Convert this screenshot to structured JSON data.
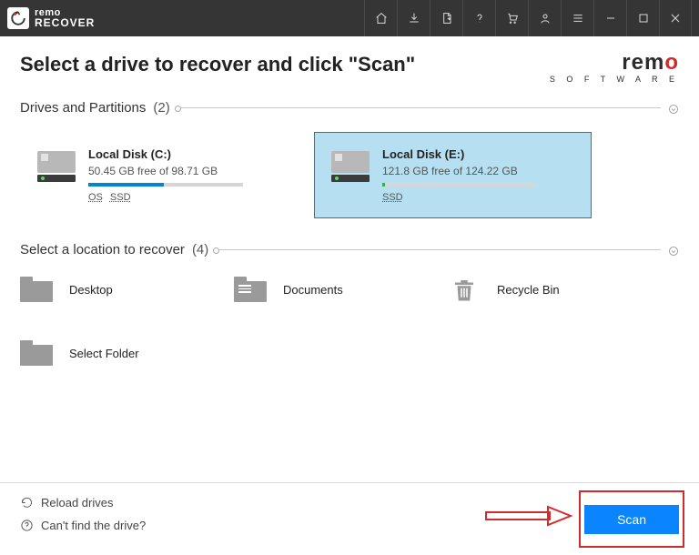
{
  "titlebar": {
    "brand": "remo",
    "product": "RECOVER"
  },
  "heading": "Select a drive to recover and click \"Scan\"",
  "brand_right": {
    "name": "remo",
    "sub": "S O F T W A R E"
  },
  "section_drives": {
    "label": "Drives and Partitions",
    "count": "(2)"
  },
  "drives": [
    {
      "name": "Local Disk (C:)",
      "free": "50.45 GB free of 98.71 GB",
      "fill_pct": 49,
      "tags": [
        "OS",
        "SSD"
      ],
      "selected": false
    },
    {
      "name": "Local Disk (E:)",
      "free": "121.8 GB free of 124.22 GB",
      "fill_pct": 2,
      "tags": [
        "SSD"
      ],
      "selected": true
    }
  ],
  "section_locations": {
    "label": "Select a location to recover",
    "count": "(4)"
  },
  "locations": [
    {
      "label": "Desktop",
      "icon": "folder"
    },
    {
      "label": "Documents",
      "icon": "folder-lines"
    },
    {
      "label": "Recycle Bin",
      "icon": "trash"
    },
    {
      "label": "Select Folder",
      "icon": "folder"
    }
  ],
  "footer": {
    "reload": "Reload drives",
    "cantfind": "Can't find the drive?",
    "scan": "Scan"
  }
}
